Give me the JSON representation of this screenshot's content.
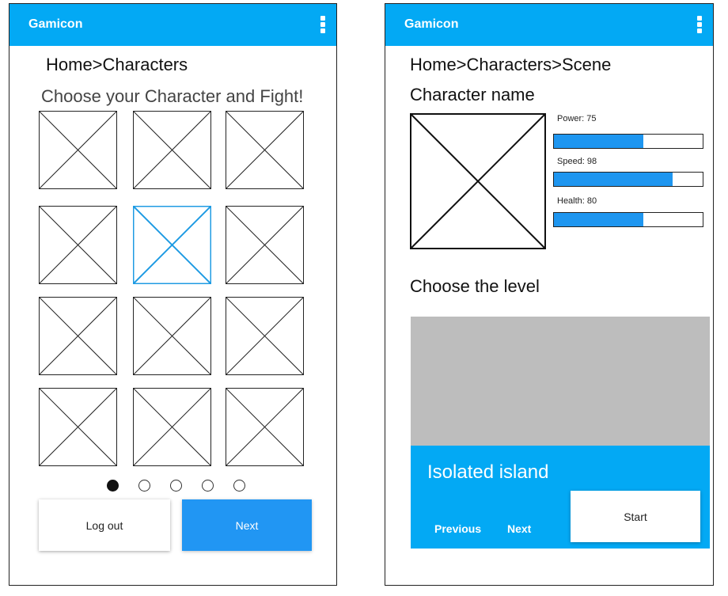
{
  "colors": {
    "appbar": "#03a9f4",
    "primary_button": "#2196f3",
    "selected_outline": "#1e9be3",
    "bar_fill": "#1e96f0",
    "preview_gray": "#bdbdbd"
  },
  "screen1": {
    "app_title": "Gamicon",
    "menu_icon": "more-vertical-icon",
    "breadcrumb": "Home>Characters",
    "heading": "Choose your Character and Fight!",
    "grid": {
      "rows": 4,
      "columns": 3,
      "selected_index": 4,
      "placeholder_icon": "image-placeholder-icon"
    },
    "pagination": {
      "pages": 5,
      "active": 1
    },
    "logout_label": "Log out",
    "next_label": "Next"
  },
  "screen2": {
    "app_title": "Gamicon",
    "menu_icon": "more-vertical-icon",
    "breadcrumb": "Home>Characters>Scene",
    "character_name": "Character name",
    "stats": [
      {
        "label": "Power: 75",
        "value": 0.6
      },
      {
        "label": "Speed: 98",
        "value": 0.8
      },
      {
        "label": "Health: 80",
        "value": 0.6
      }
    ],
    "level_heading": "Choose the level",
    "level": {
      "name": "Isolated island",
      "previous_label": "Previous",
      "next_label": "Next",
      "start_label": "Start"
    }
  }
}
